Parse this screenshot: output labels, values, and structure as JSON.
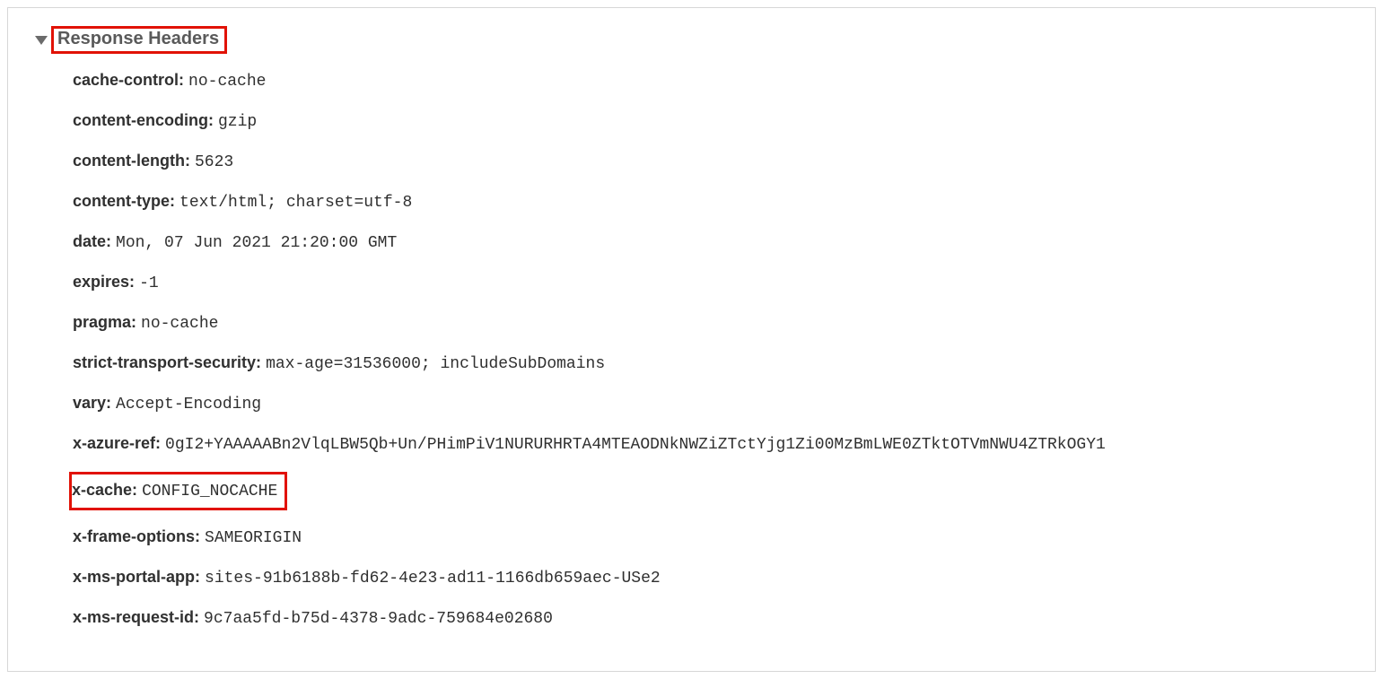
{
  "section_title": "Response Headers",
  "headers": {
    "cache_control": {
      "name": "cache-control:",
      "value": "no-cache"
    },
    "content_encoding": {
      "name": "content-encoding:",
      "value": "gzip"
    },
    "content_length": {
      "name": "content-length:",
      "value": "5623"
    },
    "content_type": {
      "name": "content-type:",
      "value": "text/html; charset=utf-8"
    },
    "date": {
      "name": "date:",
      "value": "Mon, 07 Jun 2021 21:20:00 GMT"
    },
    "expires": {
      "name": "expires:",
      "value": "-1"
    },
    "pragma": {
      "name": "pragma:",
      "value": "no-cache"
    },
    "strict_transport_security": {
      "name": "strict-transport-security:",
      "value": "max-age=31536000; includeSubDomains"
    },
    "vary": {
      "name": "vary:",
      "value": "Accept-Encoding"
    },
    "x_azure_ref": {
      "name": "x-azure-ref:",
      "value": "0gI2+YAAAAABn2VlqLBW5Qb+Un/PHimPiV1NURURHRTA4MTEAODNkNWZiZTctYjg1Zi00MzBmLWE0ZTktOTVmNWU4ZTRkOGY1"
    },
    "x_cache": {
      "name": "x-cache:",
      "value": "CONFIG_NOCACHE"
    },
    "x_frame_options": {
      "name": "x-frame-options:",
      "value": "SAMEORIGIN"
    },
    "x_ms_portal_app": {
      "name": "x-ms-portal-app:",
      "value": "sites-91b6188b-fd62-4e23-ad11-1166db659aec-USe2"
    },
    "x_ms_request_id": {
      "name": "x-ms-request-id:",
      "value": "9c7aa5fd-b75d-4378-9adc-759684e02680"
    }
  }
}
